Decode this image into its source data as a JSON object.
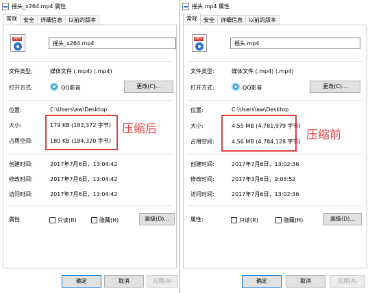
{
  "left": {
    "title": "摇头_x264.mp4 属性",
    "tabs": [
      "常规",
      "安全",
      "详细信息",
      "以前的版本"
    ],
    "filename": "摇头_x264.mp4",
    "file_type_label": "文件类型:",
    "file_type_value": "媒体文件 (.mp4) (.mp4)",
    "opens_with_label": "打开方式:",
    "opens_with_value": "QQ影音",
    "change_label": "更改(C)...",
    "location_label": "位置:",
    "location_value": "C:\\Users\\aw\\Desktop",
    "size_label": "大小:",
    "size_value": "179 KB (183,372 字节)",
    "disk_label": "占用空间:",
    "disk_value": "180 KB (184,320 字节)",
    "created_label": "创建时间:",
    "created_value": "2017年7月6日，13:04:42",
    "modified_label": "修改时间:",
    "modified_value": "2017年7月6日，13:04:42",
    "accessed_label": "访问时间:",
    "accessed_value": "2017年7月6日，13:04:42",
    "attrs_label": "属性:",
    "readonly_label": "只读(R)",
    "hidden_label": "隐藏(H)",
    "advanced_label": "高级(D)...",
    "ok_label": "确定",
    "cancel_label": "取消",
    "apply_label": "应用(A)",
    "annotation": "压缩后"
  },
  "right": {
    "title": "摇头.mp4 属性",
    "tabs": [
      "常规",
      "安全",
      "详细信息",
      "以前的版本"
    ],
    "filename": "摇头.mp4",
    "file_type_label": "文件类型:",
    "file_type_value": "媒体文件 (.mp4) (.mp4)",
    "opens_with_label": "打开方式:",
    "opens_with_value": "QQ影音",
    "change_label": "更改(C)...",
    "location_label": "位置:",
    "location_value": "C:\\Users\\aw\\Desktop",
    "size_label": "大小:",
    "size_value": "4.55 MB (4,781,979 字节)",
    "disk_label": "占用空间:",
    "disk_value": "4.56 MB (4,784,128 字节)",
    "created_label": "创建时间:",
    "created_value": "2017年7月6日，13:02:36",
    "modified_label": "修改时间:",
    "modified_value": "2017年3月6日，9:03:52",
    "accessed_label": "访问时间:",
    "accessed_value": "2017年7月6日，13:02:36",
    "attrs_label": "属性:",
    "readonly_label": "只读(R)",
    "hidden_label": "隐藏(H)",
    "advanced_label": "高级(D)...",
    "ok_label": "确定",
    "cancel_label": "取消",
    "apply_label": "应用(A)",
    "annotation": "压缩前"
  },
  "icons": {
    "file": "mp4-file-icon",
    "app": "qq-player-icon",
    "title": "file-title-icon"
  },
  "colors": {
    "annotation": "#e04040",
    "accent": "#0078d7"
  }
}
